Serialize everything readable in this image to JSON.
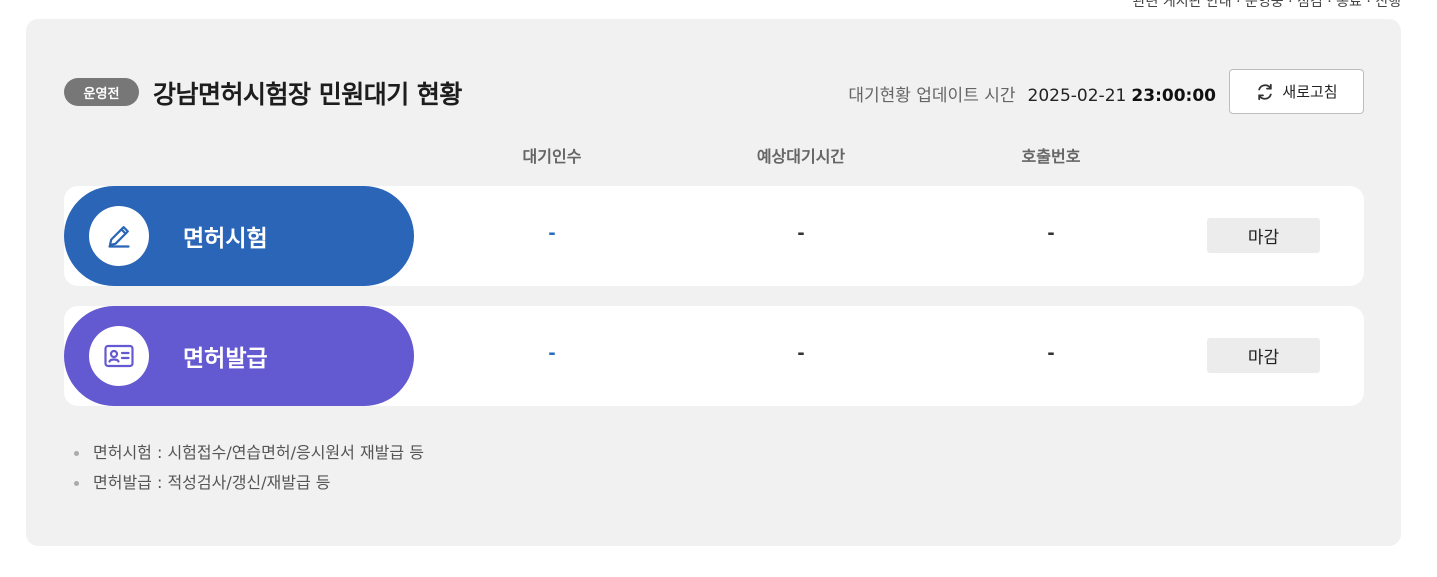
{
  "top_cropped_text": "관련 게시판 안내 · 운영중 · 점검 · 종료 · 진행",
  "panel": {
    "status_badge": "운영전",
    "title": "강남면허시험장 민원대기 현황",
    "update_label": "대기현황 업데이트 시간",
    "update_date": "2025-02-21",
    "update_time": "23:00:00",
    "refresh_label": "새로고침"
  },
  "columns": [
    "대기인수",
    "예상대기시간",
    "호출번호"
  ],
  "rows": [
    {
      "label": "면허시험",
      "icon": "pencil-icon",
      "color": "#2b65b7",
      "count": "-",
      "wait_time": "-",
      "call_number": "-",
      "status": "마감"
    },
    {
      "label": "면허발급",
      "icon": "id-card-icon",
      "color": "#6359d1",
      "count": "-",
      "wait_time": "-",
      "call_number": "-",
      "status": "마감"
    }
  ],
  "notes": [
    "면허시험 : 시험접수/연습면허/응시원서 재발급 등",
    "면허발급 : 적성검사/갱신/재발급 등"
  ],
  "colors": {
    "count_text": "#2a6dc2",
    "panel_bg": "#f1f1f1"
  }
}
